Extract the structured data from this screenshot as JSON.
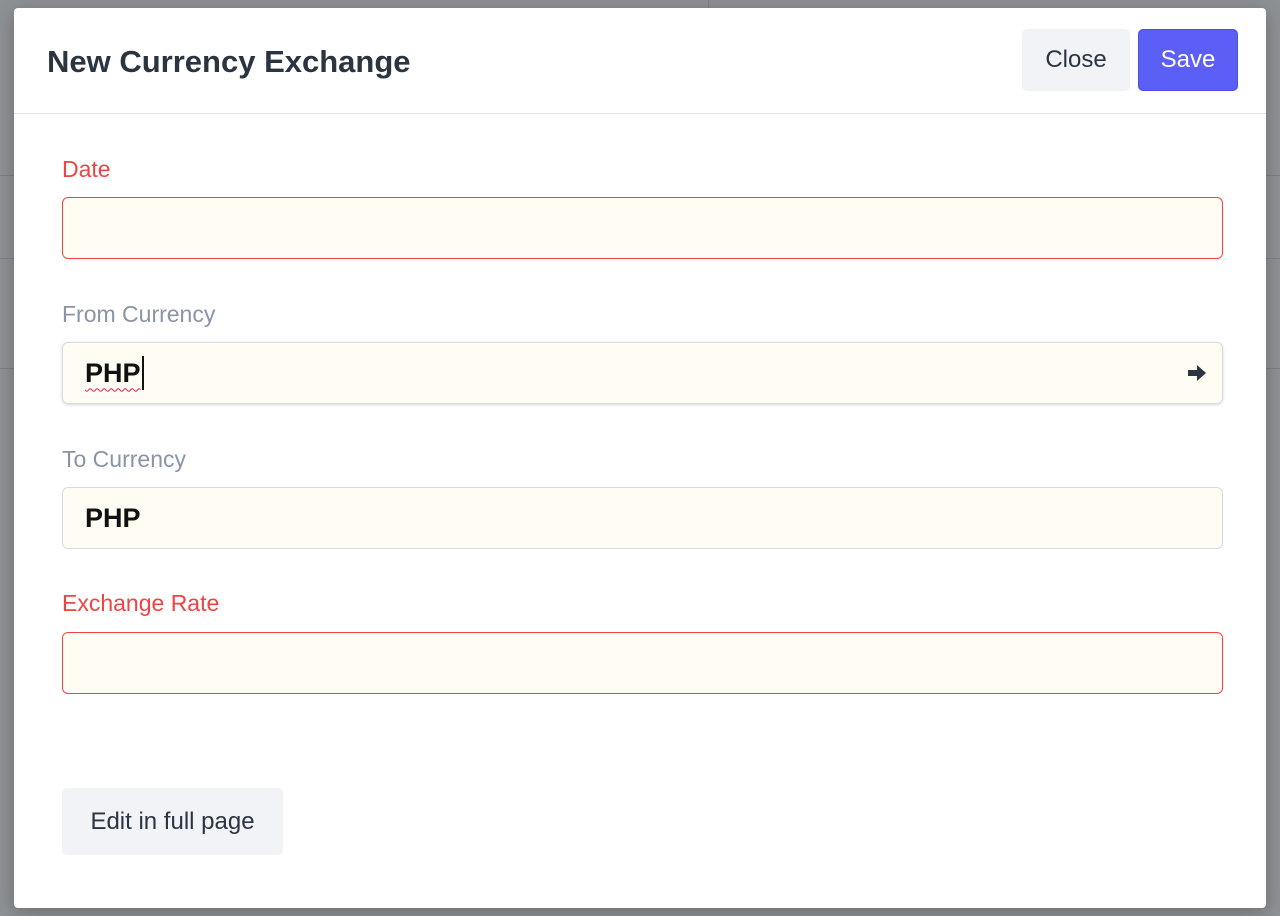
{
  "dialog": {
    "title": "New Currency Exchange",
    "close_label": "Close",
    "save_label": "Save"
  },
  "fields": {
    "date": {
      "label": "Date",
      "value": ""
    },
    "from_currency": {
      "label": "From Currency",
      "value": "PHP"
    },
    "to_currency": {
      "label": "To Currency",
      "value": "PHP"
    },
    "exchange_rate": {
      "label": "Exchange Rate",
      "value": ""
    }
  },
  "footer": {
    "full_page_label": "Edit in full page"
  },
  "colors": {
    "accent": "#5b5ff6",
    "error": "#ef4444",
    "field_bg": "#fffcf4"
  }
}
